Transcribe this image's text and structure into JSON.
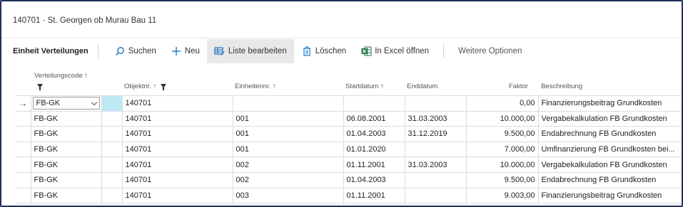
{
  "window": {
    "title": "140701 · St. Georgen ob Murau Bau 11"
  },
  "actionbar": {
    "title": "Einheit Verteilungen",
    "search": "Suchen",
    "new": "Neu",
    "edit_list": "Liste bearbeiten",
    "delete": "Löschen",
    "excel": "In Excel öffnen",
    "more": "Weitere Optionen"
  },
  "colors": {
    "accent": "#0f6cbd",
    "excel": "#217346",
    "selected_cell": "#bfe9f2"
  },
  "columns": {
    "verteilungscode": "Verteilungscode",
    "objektnr": "Objektnr.",
    "einheitennr": "Einheitennr.",
    "startdatum": "Startdatum",
    "enddatum": "Enddatum",
    "faktor": "Faktor",
    "beschreibung": "Beschreibung",
    "sort_arrow": "↑"
  },
  "rows": [
    {
      "code": "FB-GK",
      "objekt": "140701",
      "einheit": "",
      "start": "",
      "ende": "",
      "faktor": "0,00",
      "beschreibung": "Finanzierungsbeitrag Grundkosten"
    },
    {
      "code": "FB-GK",
      "objekt": "140701",
      "einheit": "001",
      "start": "06.08.2001",
      "ende": "31.03.2003",
      "faktor": "10.000,00",
      "beschreibung": "Vergabekalkulation FB Grundkosten"
    },
    {
      "code": "FB-GK",
      "objekt": "140701",
      "einheit": "001",
      "start": "01.04.2003",
      "ende": "31.12.2019",
      "faktor": "9.500,00",
      "beschreibung": "Endabrechnung FB Grundkosten"
    },
    {
      "code": "FB-GK",
      "objekt": "140701",
      "einheit": "001",
      "start": "01.01.2020",
      "ende": "",
      "faktor": "7.000,00",
      "beschreibung": "Umfinanzierung FB Grundkosten bei..."
    },
    {
      "code": "FB-GK",
      "objekt": "140701",
      "einheit": "002",
      "start": "01.11.2001",
      "ende": "31.03.2003",
      "faktor": "10.000,00",
      "beschreibung": "Vergabekalkulation FB Grundkosten"
    },
    {
      "code": "FB-GK",
      "objekt": "140701",
      "einheit": "002",
      "start": "01.04.2003",
      "ende": "",
      "faktor": "9.500,00",
      "beschreibung": "Endabrechnung FB Grundkosten"
    },
    {
      "code": "FB-GK",
      "objekt": "140701",
      "einheit": "003",
      "start": "01.11.2001",
      "ende": "",
      "faktor": "9.003,00",
      "beschreibung": "Finanzierungsbeitrag Grundkosten"
    }
  ]
}
